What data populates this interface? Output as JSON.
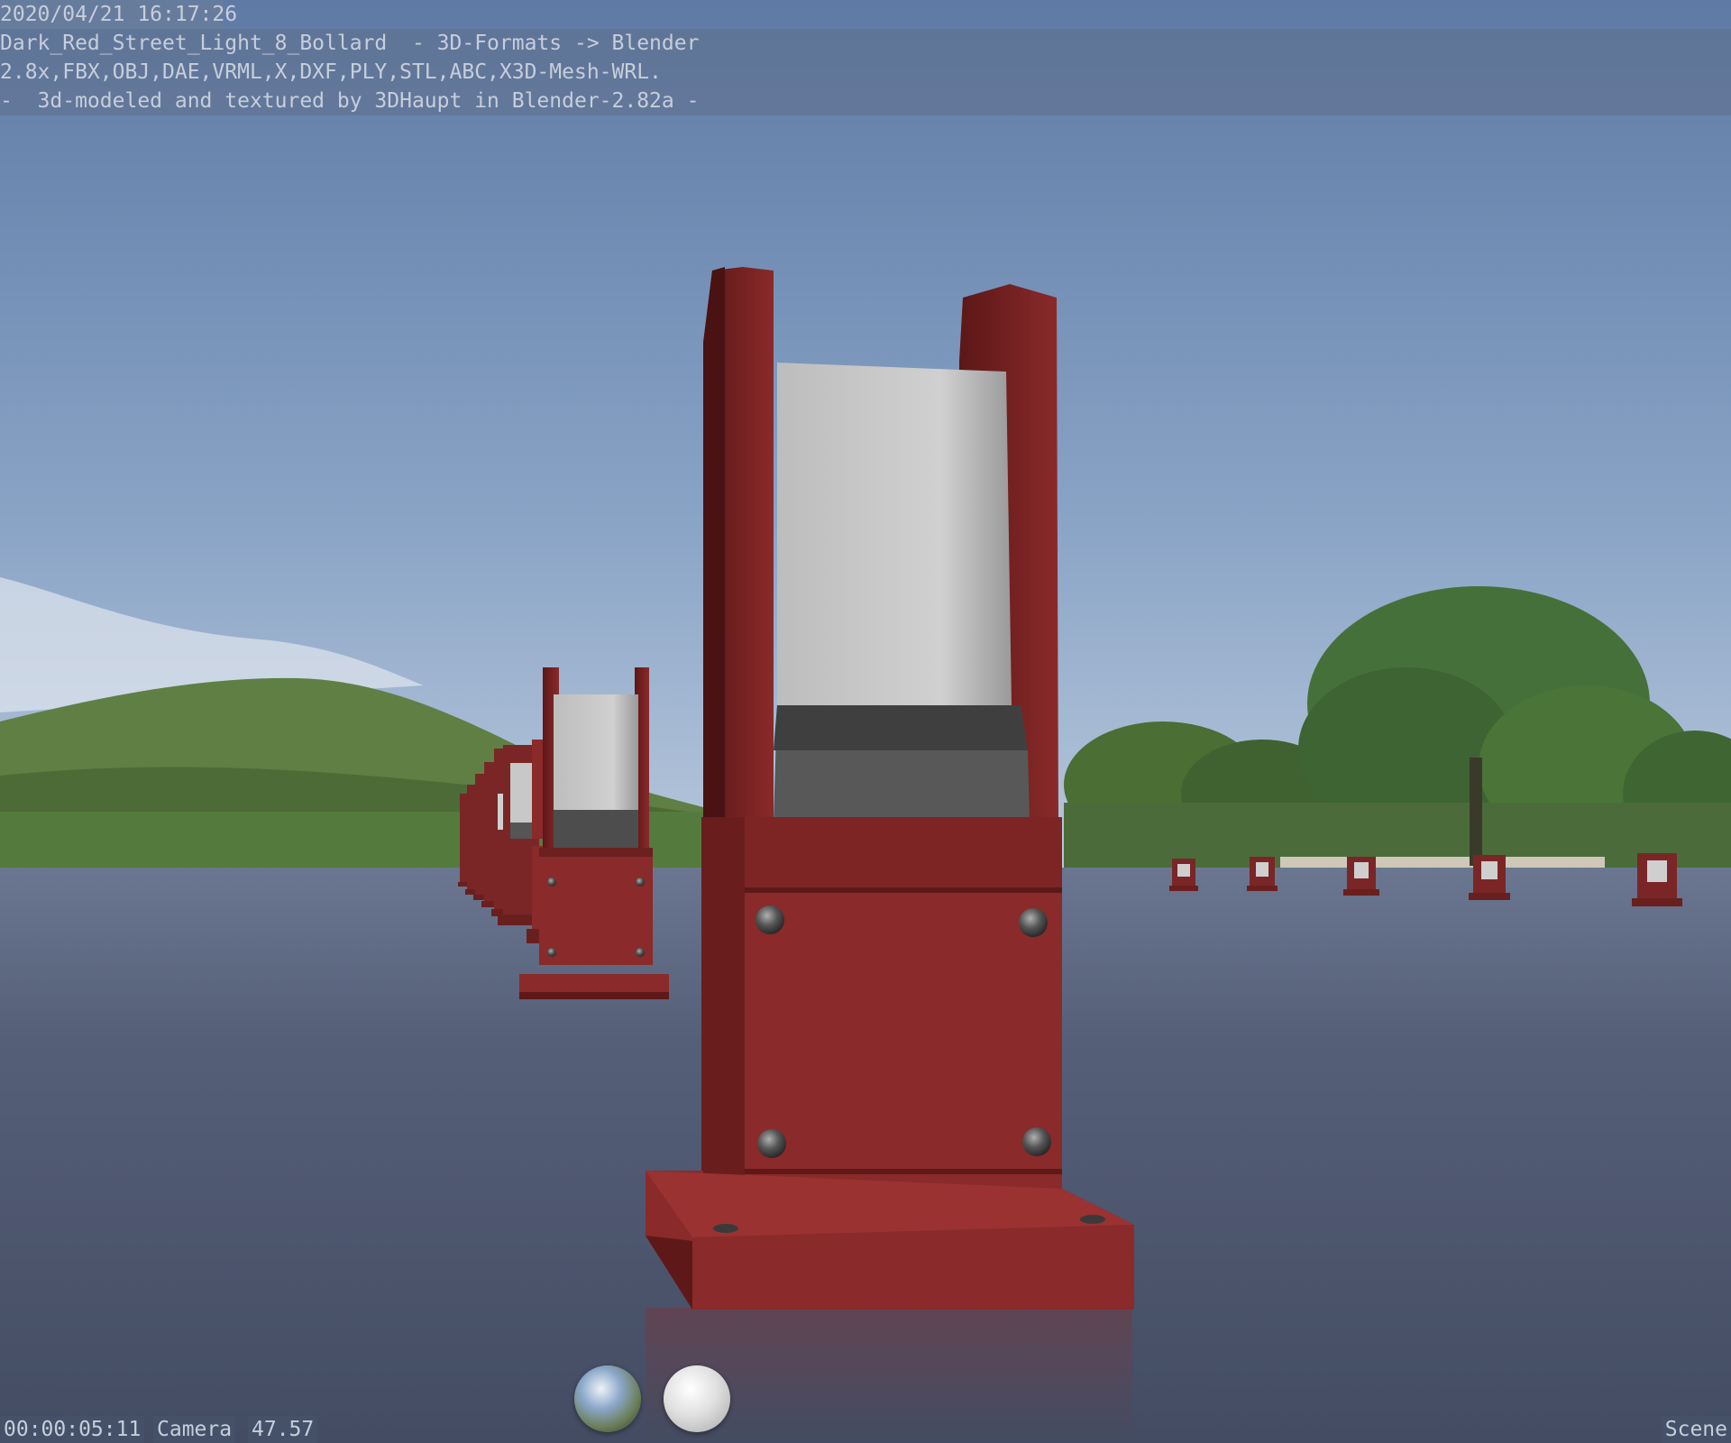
{
  "stamp": {
    "date": "2020/04/21 16:17:26",
    "note": "Dark_Red_Street_Light_8_Bollard  - 3D-Formats -> Blender\n2.8x,FBX,OBJ,DAE,VRML,X,DXF,PLY,STL,ABC,X3D-Mesh-WRL.\n-  3d-modeled and textured by 3DHaupt in Blender-2.82a -"
  },
  "footer": {
    "time": "00:00:05:11",
    "camera": "Camera",
    "lens": "47.57",
    "scene": "Scene"
  },
  "colors": {
    "bollard_red": "#8a2a2a",
    "bollard_shadow": "#5e1818",
    "lamp_glass": "#c8c8c8",
    "ground": "#4a5670",
    "sky_top": "#6a86b0"
  },
  "icons": {
    "hdri_preview": "hdri-sphere-icon",
    "material_preview": "matte-sphere-icon"
  }
}
